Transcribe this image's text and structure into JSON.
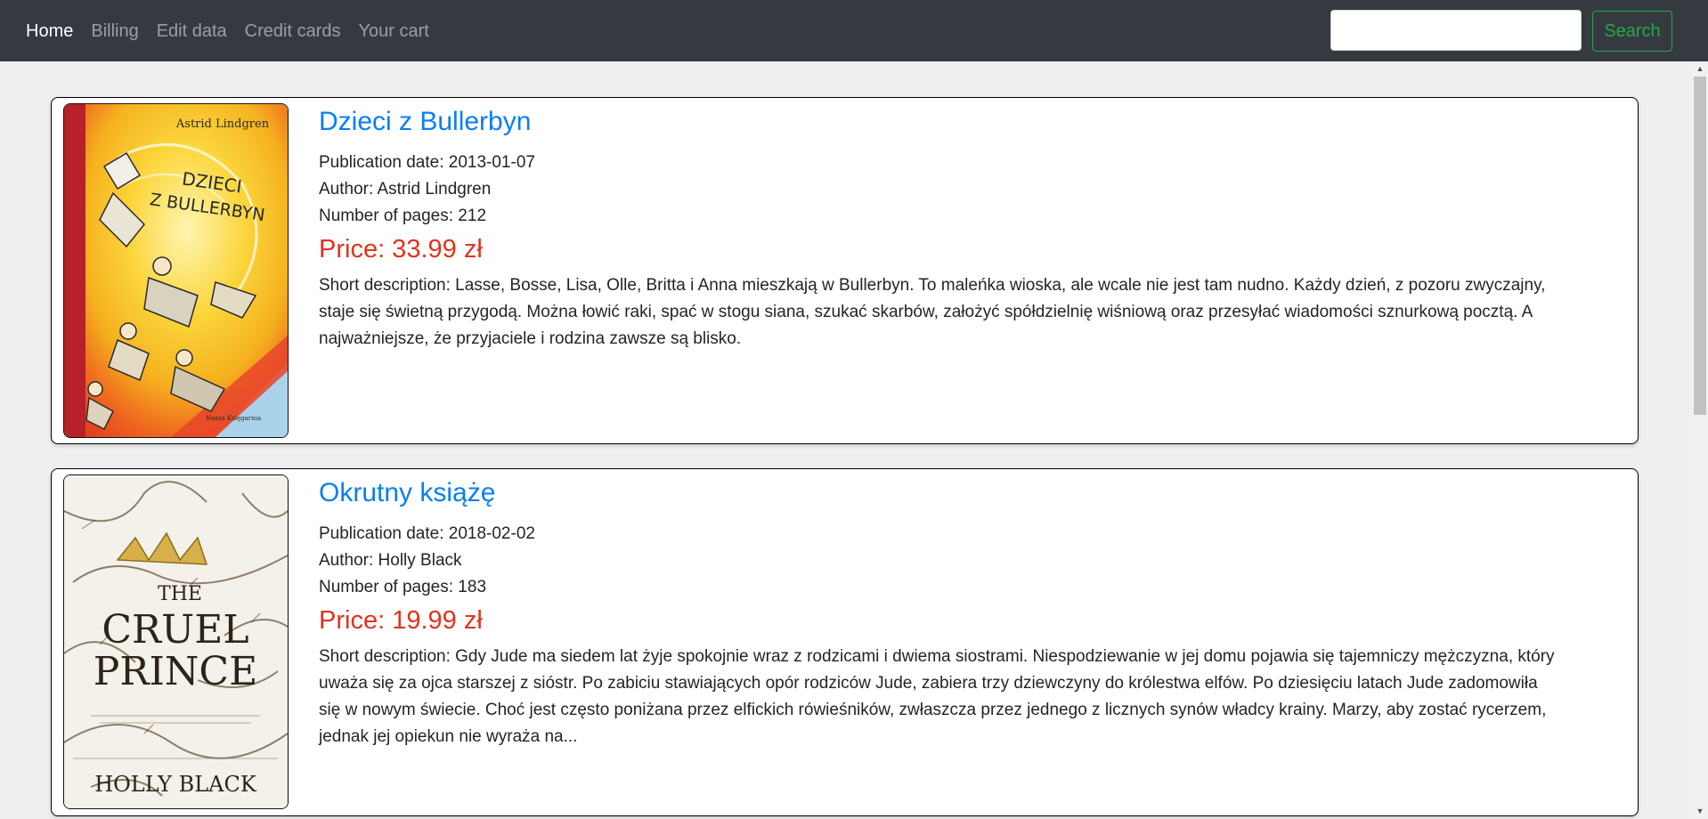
{
  "nav": {
    "items": [
      {
        "label": "Home",
        "active": true
      },
      {
        "label": "Billing",
        "active": false
      },
      {
        "label": "Edit data",
        "active": false
      },
      {
        "label": "Credit cards",
        "active": false
      },
      {
        "label": "Your cart",
        "active": false
      }
    ],
    "search_value": "",
    "search_button": "Search"
  },
  "books": [
    {
      "title": "Dzieci z Bullerbyn",
      "publication_date": "Publication date: 2013-01-07",
      "author": "Author: Astrid Lindgren",
      "pages": "Number of pages: 212",
      "price": "Price: 33.99 zł",
      "description": "Short description: Lasse, Bosse, Lisa, Olle, Britta i Anna mieszkają w Bullerbyn. To maleńka wioska, ale wcale nie jest tam nudno. Każdy dzień, z pozoru zwyczajny, staje się świetną przygodą. Można łowić raki, spać w stogu siana, szukać skarbów, założyć spółdzielnię wiśniową oraz przesyłać wiadomości sznurkową pocztą. A najważniejsze, że przyjaciele i rodzina zawsze są blisko.",
      "cover": {
        "author_text": "Astrid Lindgren",
        "title_line1": "DZIECI",
        "title_line2": "Z BULLERBYN",
        "publisher": "Nasza Księgarnia"
      }
    },
    {
      "title": "Okrutny książę",
      "publication_date": "Publication date: 2018-02-02",
      "author": "Author: Holly Black",
      "pages": "Number of pages: 183",
      "price": "Price: 19.99 zł",
      "description": "Short description: Gdy Jude ma siedem lat żyje spokojnie wraz z rodzicami i dwiema siostrami. Niespodziewanie w jej domu pojawia się tajemniczy mężczyzna, który uważa się za ojca starszej z sióstr. Po zabiciu stawiających opór rodziców Jude, zabiera trzy dziewczyny do królestwa elfów. Po dziesięciu latach Jude zadomowiła się w nowym świecie. Choć jest często poniżana przez elfickich rówieśników, zwłaszcza przez jednego z licznych synów władcy krainy. Marzy, aby zostać rycerzem, jednak jej opiekun nie wyraża na...",
      "cover": {
        "title_line1": "THE",
        "title_line2": "CRUEL",
        "title_line3": "PRINCE",
        "author_text": "HOLLY BLACK"
      }
    }
  ],
  "colors": {
    "navbar_bg": "#343a40",
    "link_blue": "#0a7ef4",
    "price_red": "#e1341e",
    "search_green": "#28a745"
  }
}
